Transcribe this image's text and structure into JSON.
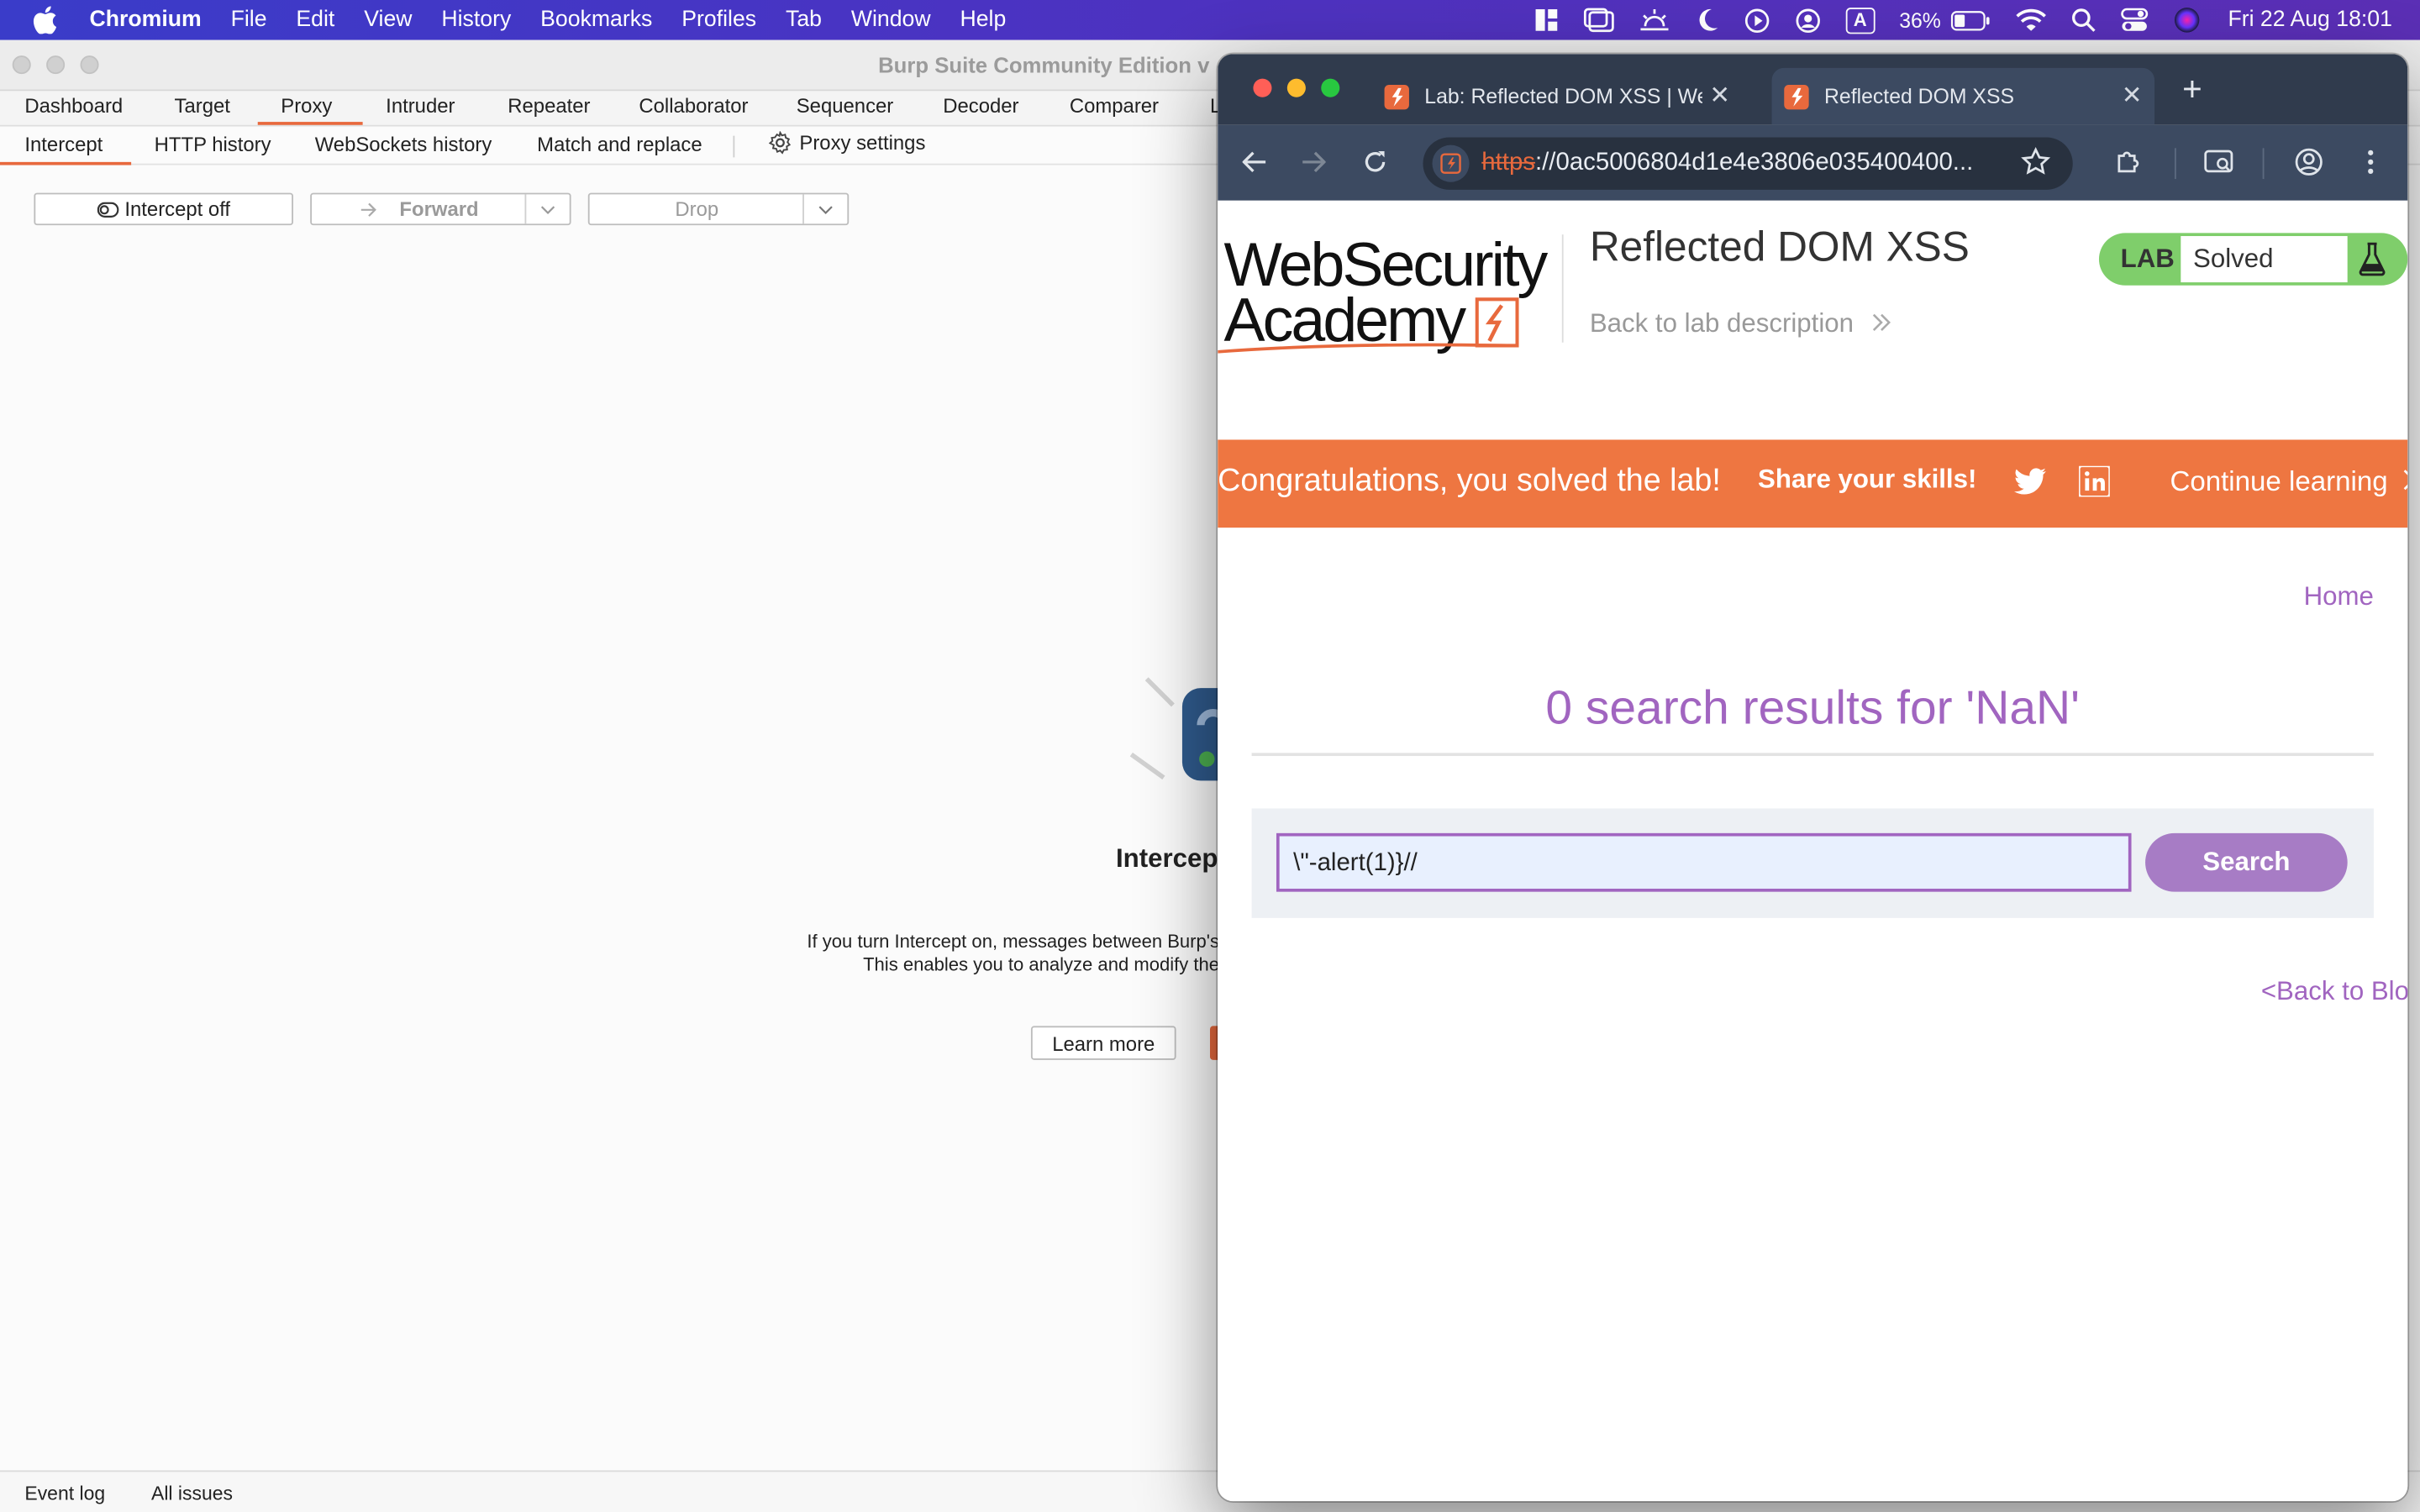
{
  "menubar": {
    "app": "Chromium",
    "menus": [
      "File",
      "Edit",
      "View",
      "History",
      "Bookmarks",
      "Profiles",
      "Tab",
      "Window",
      "Help"
    ],
    "battery": "36%",
    "battery_level": 0.36,
    "input_source": "A",
    "clock": "Fri 22 Aug  18:01"
  },
  "burp": {
    "window_title": "Burp Suite Community Edition v",
    "main_tabs": [
      "Dashboard",
      "Target",
      "Proxy",
      "Intruder",
      "Repeater",
      "Collaborator",
      "Sequencer",
      "Decoder",
      "Comparer",
      "L"
    ],
    "active_main_tab": "Proxy",
    "sub_tabs": [
      "Intercept",
      "HTTP history",
      "WebSockets history",
      "Match and replace"
    ],
    "proxy_settings": "Proxy settings",
    "intercept_btn": "Intercept off",
    "forward_btn": "Forward",
    "drop_btn": "Drop",
    "heading": "Intercep",
    "desc_line1": "If you turn Intercept on, messages between Burp's",
    "desc_line2": "This enables you to analyze and modify the",
    "learn_more": "Learn more",
    "status": [
      "Event log",
      "All issues"
    ]
  },
  "browser": {
    "tabs": [
      {
        "title": "Lab: Reflected DOM XSS | We",
        "active": false
      },
      {
        "title": "Reflected DOM XSS",
        "active": true
      }
    ],
    "url_scheme": "https",
    "url_rest": "://0ac5006804d1e4e3806e035400400..."
  },
  "page": {
    "logo_line1": "WebSecurity",
    "logo_line2": "Academy",
    "lab_title": "Reflected DOM XSS",
    "back_to_desc": "Back to lab description",
    "lab_label": "LAB",
    "lab_status": "Solved",
    "banner_congrats": "Congratulations, you solved the lab!",
    "banner_share": "Share your skills!",
    "banner_continue": "Continue learning",
    "home": "Home",
    "results_heading": "0 search results for 'NaN'",
    "search_value": "\\\"-alert(1)}//",
    "search_button": "Search",
    "back_to_blog": "<Back to Blo"
  },
  "colors": {
    "accent_orange": "#e8693d",
    "banner_orange": "#ee7641",
    "link_purple": "#a165c0",
    "lab_green": "#7fce6b"
  }
}
